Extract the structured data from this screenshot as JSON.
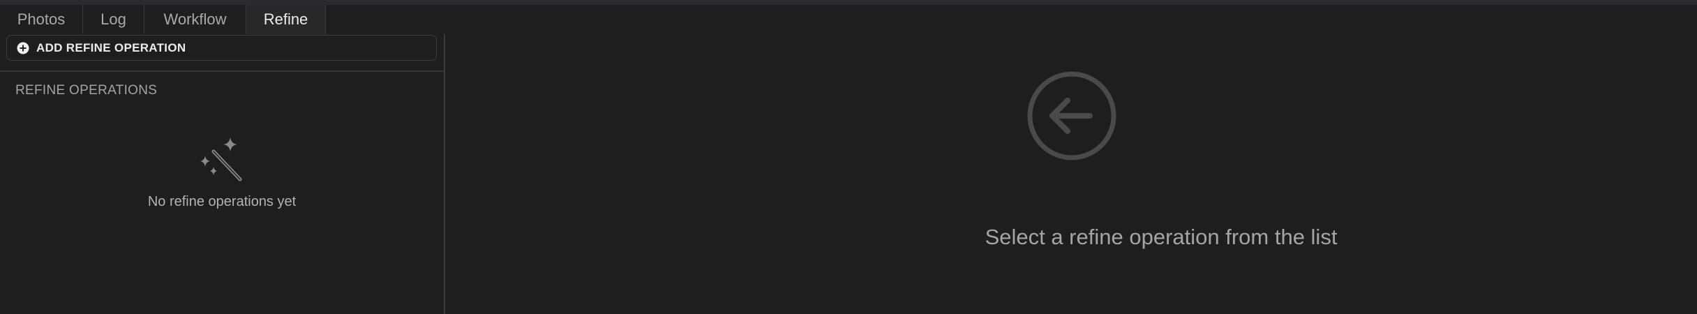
{
  "tabs": [
    {
      "label": "Photos",
      "active": false
    },
    {
      "label": "Log",
      "active": false
    },
    {
      "label": "Workflow",
      "active": false
    },
    {
      "label": "Refine",
      "active": true
    }
  ],
  "sidebar": {
    "add_button_label": "ADD REFINE OPERATION",
    "section_title": "REFINE OPERATIONS",
    "empty_icon": "magic-wand-icon",
    "empty_text": "No refine operations yet"
  },
  "detail": {
    "icon": "arrow-left-circle-icon",
    "message": "Select a refine operation from the list"
  },
  "colors": {
    "background": "#1e1e1e",
    "active_tab_bg": "#282828",
    "border": "#3b3b3b",
    "icon_gray": "#4a4a4a"
  }
}
